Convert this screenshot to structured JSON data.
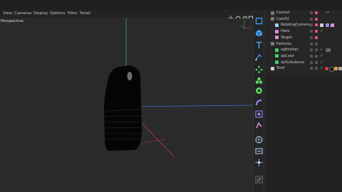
{
  "menu": {
    "items": [
      "View",
      "Cameras",
      "Display",
      "Options",
      "Filter",
      "Panel"
    ]
  },
  "viewport": {
    "label": "Perspective"
  },
  "objects": [
    {
      "name": "Control",
      "icon": "null-icon",
      "color": "#8e8ef0"
    },
    {
      "name": "Cam02",
      "icon": "camera-icon",
      "color": "#9ad0ff"
    },
    {
      "name": "RotatingCamera",
      "icon": "camera-icon",
      "color": "#9ad0ff"
    },
    {
      "name": "Helix",
      "icon": "spline-icon",
      "color": "#e08fd8"
    },
    {
      "name": "Target",
      "icon": "spline-icon",
      "color": "#e08fd8"
    },
    {
      "name": "Particles",
      "icon": "null-icon",
      "color": "#bfbfbf"
    },
    {
      "name": "xpEmitter",
      "icon": "emitter-icon",
      "color": "#3fcf6a"
    },
    {
      "name": "xpColor",
      "icon": "xp-icon",
      "color": "#3fcf6a"
    },
    {
      "name": "xpTurbulence",
      "icon": "xp-icon",
      "color": "#3fcf6a"
    },
    {
      "name": "Shirt",
      "icon": "polygon-icon",
      "color": "#cfcfcf"
    }
  ],
  "colors": {
    "accent": "#4aa3ff",
    "tag_pink": "#e8508f",
    "check_green": "#5fd15f"
  }
}
